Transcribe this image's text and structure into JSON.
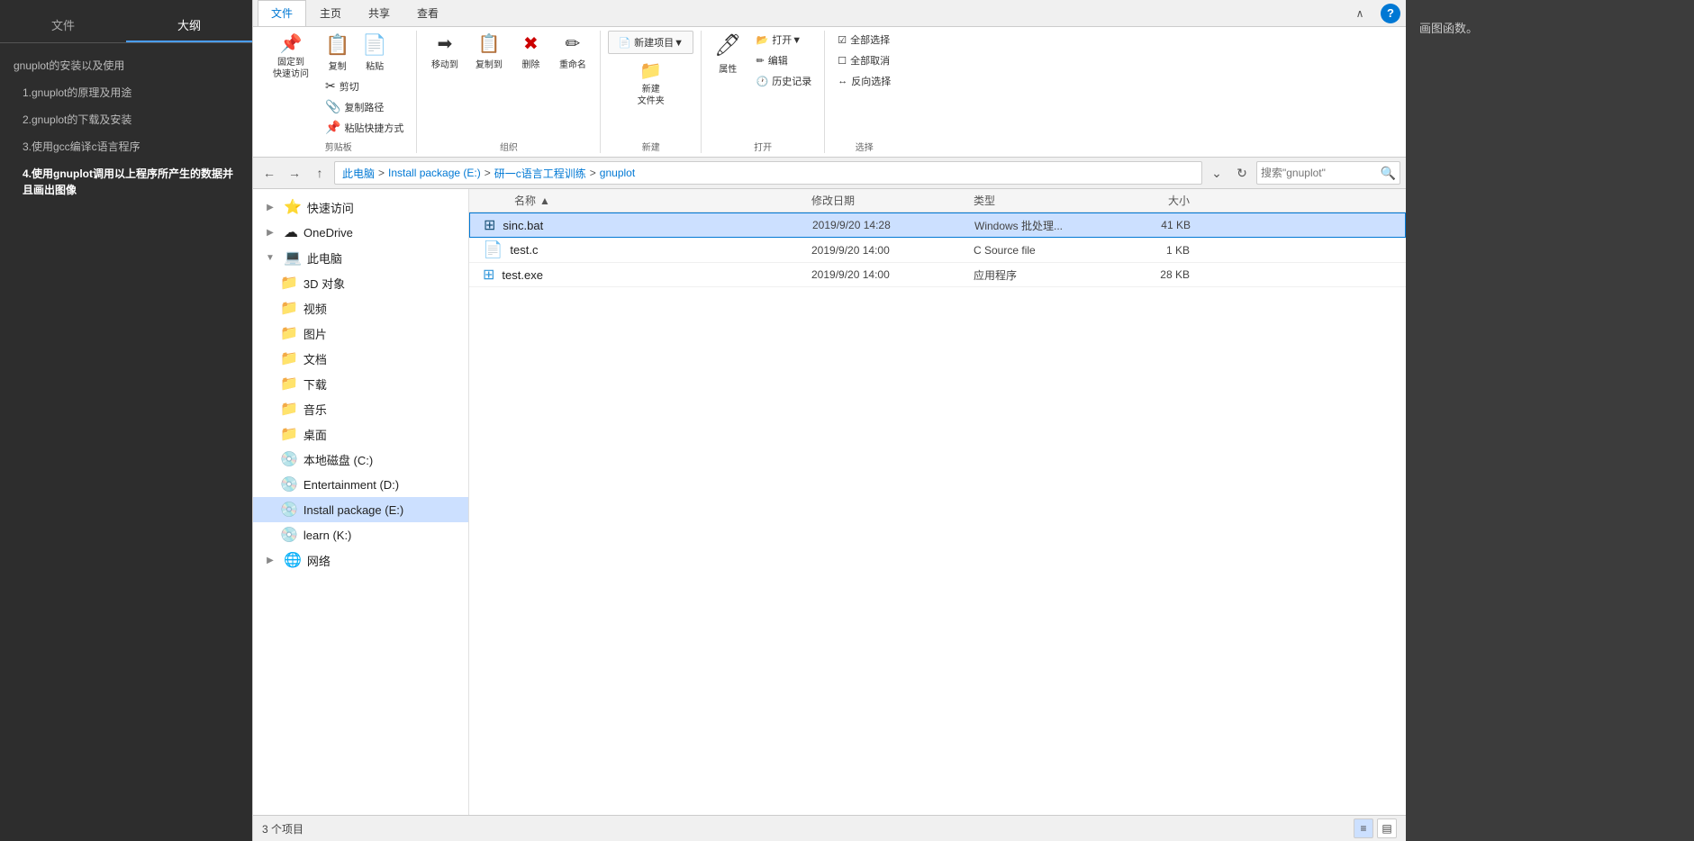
{
  "leftSidebar": {
    "tabs": [
      {
        "id": "wenJian",
        "label": "文件",
        "active": false
      },
      {
        "id": "daGang",
        "label": "大纲",
        "active": true
      }
    ],
    "outlineItems": [
      {
        "id": "item0",
        "label": "gnuplot的安装以及使用",
        "indent": 0
      },
      {
        "id": "item1",
        "label": "1.gnuplot的原理及用途",
        "indent": 1
      },
      {
        "id": "item2",
        "label": "2.gnuplot的下载及安装",
        "indent": 1
      },
      {
        "id": "item3",
        "label": "3.使用gcc编译c语言程序",
        "indent": 1
      },
      {
        "id": "item4",
        "label": "4.使用gnuplot调用以上程序所产生的数据并且画出图像",
        "indent": 1,
        "highlighted": true
      }
    ]
  },
  "ribbon": {
    "tabs": [
      {
        "id": "file",
        "label": "文件",
        "active": true
      },
      {
        "id": "home",
        "label": "主页",
        "active": false
      },
      {
        "id": "share",
        "label": "共享",
        "active": false
      },
      {
        "id": "view",
        "label": "查看",
        "active": false
      }
    ],
    "groups": {
      "clipboard": {
        "label": "剪贴板",
        "mainBtn": {
          "icon": "📌",
          "label": "固定到\n快速访问"
        },
        "buttons": [
          {
            "icon": "📋",
            "label": "复制"
          },
          {
            "icon": "📄",
            "label": "粘贴"
          }
        ],
        "smallBtns": [
          {
            "icon": "✂",
            "label": "剪切"
          },
          {
            "icon": "📎",
            "label": "复制路径"
          },
          {
            "icon": "📌",
            "label": "粘贴快捷方式"
          }
        ]
      },
      "organize": {
        "label": "组织",
        "buttons": [
          {
            "icon": "➡",
            "label": "移动到"
          },
          {
            "icon": "📋",
            "label": "复制到"
          },
          {
            "icon": "❌",
            "label": "删除"
          },
          {
            "icon": "✏",
            "label": "重命名"
          }
        ]
      },
      "new": {
        "label": "新建",
        "buttons": [
          {
            "icon": "📁",
            "label": "新建\n文件夹"
          }
        ],
        "dropdowns": [
          {
            "icon": "📄",
            "label": "新建项目▼"
          }
        ]
      },
      "open": {
        "label": "打开",
        "buttons": [
          {
            "icon": "🖊",
            "label": "属性"
          }
        ],
        "smallBtns": [
          {
            "icon": "📂",
            "label": "打开▼"
          },
          {
            "icon": "✏",
            "label": "编辑"
          },
          {
            "icon": "🕐",
            "label": "历史记录"
          }
        ]
      },
      "select": {
        "label": "选择",
        "smallBtns": [
          {
            "icon": "☑",
            "label": "全部选择"
          },
          {
            "icon": "☐",
            "label": "全部取消"
          },
          {
            "icon": "↔",
            "label": "反向选择"
          }
        ]
      }
    }
  },
  "addressBar": {
    "pathParts": [
      "此电脑",
      "Install package (E:)",
      "研一c语言工程训练",
      "gnuplot"
    ],
    "searchPlaceholder": "搜索\"gnuplot\"",
    "refreshIcon": "🔄"
  },
  "navTree": {
    "items": [
      {
        "id": "quickAccess",
        "label": "快速访问",
        "icon": "⭐",
        "indent": 0
      },
      {
        "id": "oneDrive",
        "label": "OneDrive",
        "icon": "☁",
        "indent": 0
      },
      {
        "id": "thisPC",
        "label": "此电脑",
        "icon": "💻",
        "indent": 0
      },
      {
        "id": "3dObjects",
        "label": "3D 对象",
        "icon": "📁",
        "indent": 1
      },
      {
        "id": "videos",
        "label": "视频",
        "icon": "📁",
        "indent": 1
      },
      {
        "id": "pictures",
        "label": "图片",
        "icon": "📁",
        "indent": 1
      },
      {
        "id": "documents",
        "label": "文档",
        "icon": "📁",
        "indent": 1
      },
      {
        "id": "downloads",
        "label": "下载",
        "icon": "📁",
        "indent": 1
      },
      {
        "id": "music",
        "label": "音乐",
        "icon": "📁",
        "indent": 1
      },
      {
        "id": "desktop",
        "label": "桌面",
        "icon": "📁",
        "indent": 1
      },
      {
        "id": "localDiskC",
        "label": "本地磁盘 (C:)",
        "icon": "💾",
        "indent": 1
      },
      {
        "id": "entertainmentD",
        "label": "Entertainment (D:)",
        "icon": "💾",
        "indent": 1
      },
      {
        "id": "installPackageE",
        "label": "Install  package (E:)",
        "icon": "💾",
        "indent": 1,
        "selected": true
      },
      {
        "id": "learnK",
        "label": "learn (K:)",
        "icon": "💾",
        "indent": 1
      },
      {
        "id": "network",
        "label": "网络",
        "icon": "🌐",
        "indent": 0
      }
    ]
  },
  "fileList": {
    "columns": [
      {
        "id": "name",
        "label": "名称"
      },
      {
        "id": "date",
        "label": "修改日期"
      },
      {
        "id": "type",
        "label": "类型"
      },
      {
        "id": "size",
        "label": "大小"
      }
    ],
    "files": [
      {
        "id": "sinc-bat",
        "name": "sinc.bat",
        "icon": "⬛",
        "iconColor": "#1a5276",
        "date": "2019/9/20 14:28",
        "type": "Windows 批处理...",
        "size": "41 KB",
        "selected": true
      },
      {
        "id": "test-c",
        "name": "test.c",
        "icon": "📄",
        "iconColor": "#e74c3c",
        "date": "2019/9/20 14:00",
        "type": "C Source file",
        "size": "1 KB",
        "selected": false
      },
      {
        "id": "test-exe",
        "name": "test.exe",
        "icon": "⬛",
        "iconColor": "#3498db",
        "date": "2019/9/20 14:00",
        "type": "应用程序",
        "size": "28 KB",
        "selected": false
      }
    ]
  },
  "statusBar": {
    "itemCount": "3 个项目",
    "viewBtns": [
      {
        "id": "list-view",
        "icon": "≡",
        "active": true
      },
      {
        "id": "detail-view",
        "icon": "▤",
        "active": false
      }
    ]
  },
  "rightPanel": {
    "text": "画图函数。"
  },
  "windowControls": {
    "collapseLabel": "🗕",
    "maximizeLabel": "🗖",
    "helpLabel": "?"
  }
}
